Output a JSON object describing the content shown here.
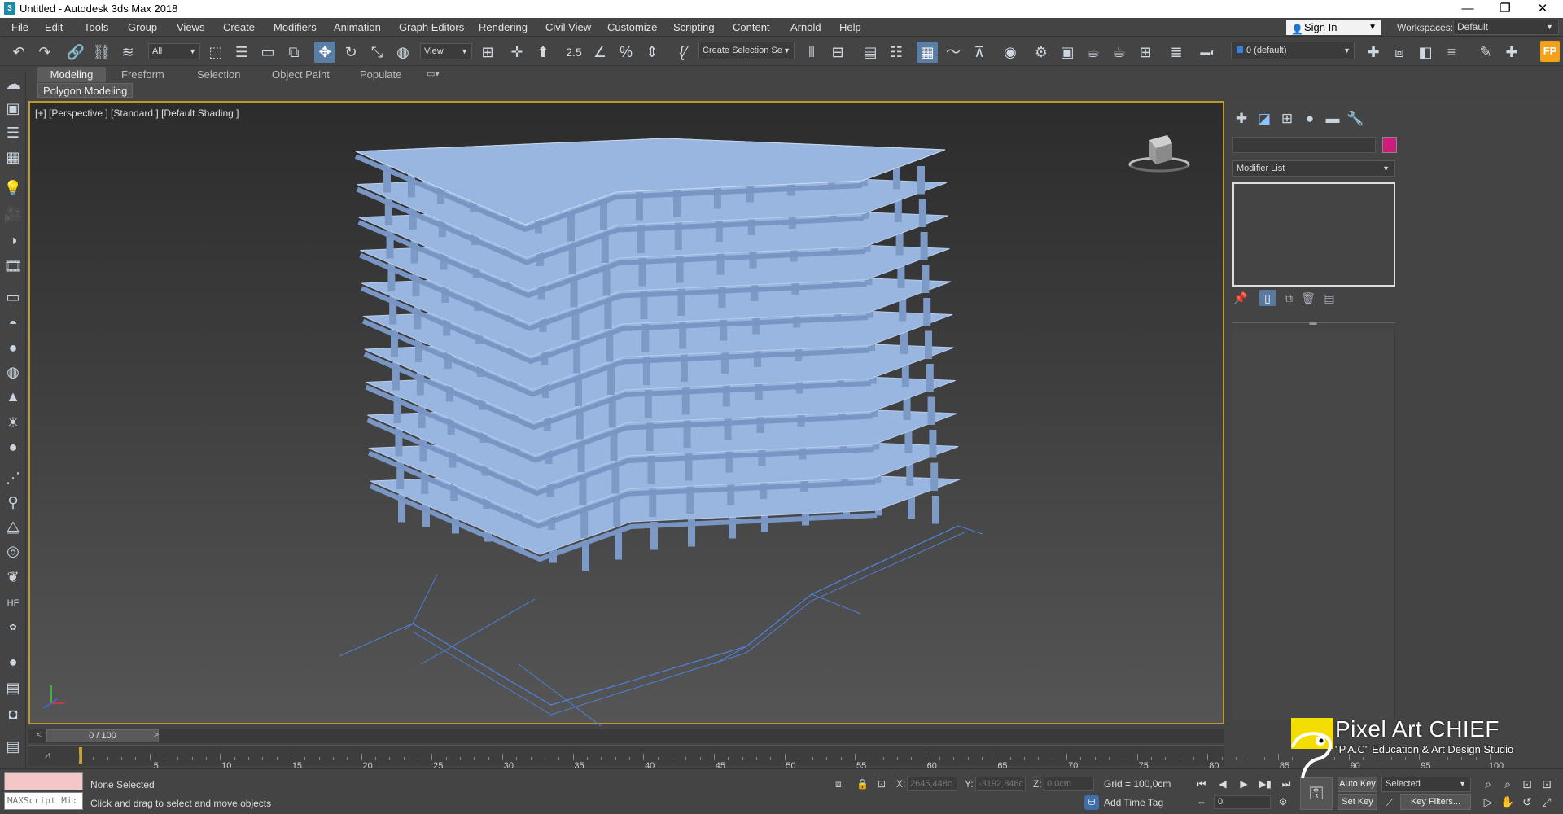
{
  "window": {
    "title": "Untitled - Autodesk 3ds Max 2018",
    "app_icon": "3"
  },
  "menu": {
    "items": [
      "File",
      "Edit",
      "Tools",
      "Group",
      "Views",
      "Create",
      "Modifiers",
      "Animation",
      "Graph Editors",
      "Rendering",
      "Civil View",
      "Customize",
      "Scripting",
      "Content",
      "Arnold",
      "Help"
    ],
    "sign_in": "Sign In",
    "workspaces_label": "Workspaces:",
    "workspace_value": "Default"
  },
  "toolbar": {
    "selection_filter": "All",
    "ref_coord": "View",
    "snap_label": "2.5",
    "create_selection_set": "Create Selection Se",
    "layer_combo": "0 (default)"
  },
  "ribbon": {
    "tabs": [
      "Modeling",
      "Freeform",
      "Selection",
      "Object Paint",
      "Populate"
    ],
    "active_tab": "Modeling",
    "subtab": "Polygon Modeling"
  },
  "viewport": {
    "label": "[+] [Perspective ] [Standard ] [Default Shading ]",
    "floors": 11,
    "model_color": "#98b6e0",
    "grid_color": "#4f7fd6",
    "border_color": "#b99b2c"
  },
  "command_panel": {
    "modifier_list": "Modifier List",
    "object_color": "#cc1d7a"
  },
  "timeline": {
    "slider": "0 / 100",
    "ticks": [
      5,
      10,
      15,
      20,
      25,
      30,
      35,
      40,
      45,
      50,
      55,
      60,
      65,
      70,
      75,
      80,
      85,
      90,
      95,
      100
    ]
  },
  "status": {
    "maxscript": "MAXScript Mi:",
    "selection": "None Selected",
    "prompt": "Click and drag to select and move objects",
    "x_label": "X:",
    "x_value": "2645,448c",
    "y_label": "Y:",
    "y_value": "-3192,846c",
    "z_label": "Z:",
    "z_value": "0,0cm",
    "grid": "Grid = 100,0cm",
    "add_time_tag": "Add Time Tag",
    "frame": "0",
    "auto_key": "Auto Key",
    "set_key": "Set Key",
    "key_mode": "Selected",
    "key_filters": "Key Filters..."
  },
  "watermark": {
    "title": "Pixel Art CHIEF",
    "subtitle": "\"P.A.C\" Education & Art Design Studio"
  }
}
